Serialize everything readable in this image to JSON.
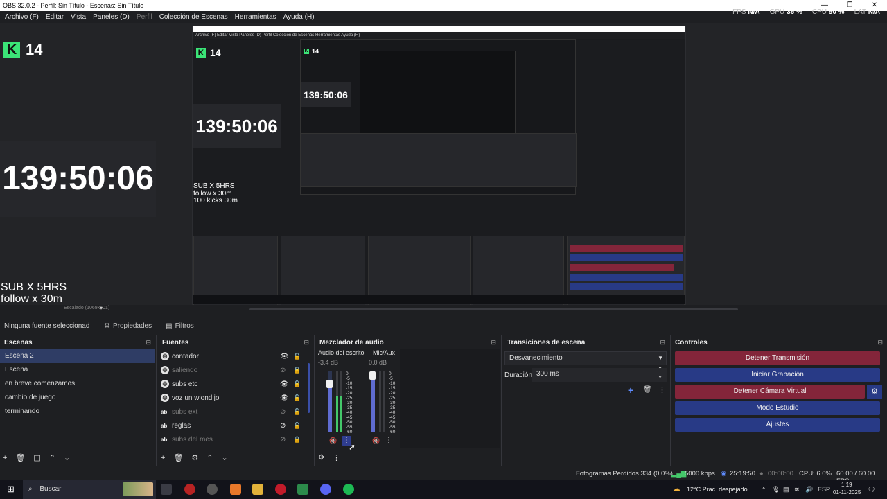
{
  "window": {
    "title": "OBS 32.0.2 - Perfil: Sin Título - Escenas: Sin Título",
    "controls": [
      "—",
      "❐",
      "✕"
    ]
  },
  "menu": [
    {
      "label": "Archivo (F)",
      "dim": false
    },
    {
      "label": "Editar",
      "dim": false
    },
    {
      "label": "Vista",
      "dim": false
    },
    {
      "label": "Paneles (D)",
      "dim": false
    },
    {
      "label": "Perfil",
      "dim": true
    },
    {
      "label": "Colección de Escenas",
      "dim": false
    },
    {
      "label": "Herramientas",
      "dim": false
    },
    {
      "label": "Ayuda (H)",
      "dim": false
    }
  ],
  "stats": {
    "fps_label": "FPS",
    "fps": "N/A",
    "gpu_label": "GPU",
    "gpu": "36 %",
    "cpu_label": "CPU",
    "cpu": "50 %",
    "lat_label": "LAT",
    "lat": "N/A"
  },
  "preview": {
    "kick_count": "14",
    "timer": "139:50:06",
    "sub_lines": [
      "SUB X 5HRS",
      "follow x 30m",
      "100 kicks 30m"
    ],
    "scale_label": "Escalado (1069x601)"
  },
  "source_toolbar": {
    "no_selection": "Ninguna fuente seleccionad",
    "properties": "Propiedades",
    "filters": "Filtros"
  },
  "scenes": {
    "title": "Escenas",
    "items": [
      "Escena 2",
      "Escena",
      "en breve comenzamos",
      "cambio de juego",
      "terminando"
    ],
    "selected": 0
  },
  "sources": {
    "title": "Fuentes",
    "items": [
      {
        "name": "contador",
        "type": "globe",
        "hidden": false
      },
      {
        "name": "saliendo",
        "type": "globe",
        "hidden": true
      },
      {
        "name": "subs etc",
        "type": "globe",
        "hidden": false
      },
      {
        "name": "voz un wiondijo",
        "type": "globe",
        "hidden": false
      },
      {
        "name": "subs ext",
        "type": "text",
        "hidden": true
      },
      {
        "name": "reglas",
        "type": "text",
        "hidden": false
      },
      {
        "name": "subs del mes",
        "type": "text",
        "hidden": true
      }
    ]
  },
  "mixer": {
    "title": "Mezclador de audio",
    "channels": [
      {
        "name": "Audio del escritoric",
        "db": "-3.4 dB",
        "level": 0.85
      },
      {
        "name": "Mic/Aux",
        "db": "0.0 dB",
        "level": 1.0
      }
    ],
    "scale": [
      "0",
      "-5",
      "-10",
      "-15",
      "-20",
      "-25",
      "-30",
      "-35",
      "-40",
      "-45",
      "-50",
      "-55",
      "-60"
    ]
  },
  "transitions": {
    "title": "Transiciones de escena",
    "selected": "Desvanecimiento",
    "duration_label": "Duración",
    "duration_value": "300 ms"
  },
  "controls": {
    "title": "Controles",
    "buttons": [
      {
        "label": "Detener Transmisión",
        "color": "#83253a"
      },
      {
        "label": "Iniciar Grabación",
        "color": "#283a86"
      },
      {
        "label": "Detener Cámara Virtual",
        "color": "#83253a"
      },
      {
        "label": "Modo Estudio",
        "color": "#283a86"
      },
      {
        "label": "Ajustes",
        "color": "#283a86"
      }
    ]
  },
  "status": {
    "dropped": "Fotogramas Perdidos 334 (0.0%)",
    "bitrate": "5000 kbps",
    "stream_time": "25:19:50",
    "rec_time": "00:00:00",
    "cpu": "CPU: 6.0%",
    "fps": "60.00 / 60.00 FPS"
  },
  "taskbar": {
    "search": "Buscar",
    "weather": "12°C  Prac. despejado",
    "lang": "ESP",
    "time": "1:19",
    "date": "01-11-2025"
  },
  "colors": {
    "accent_red": "#83253a",
    "accent_blue": "#283a86",
    "kick_green": "#3be477"
  }
}
